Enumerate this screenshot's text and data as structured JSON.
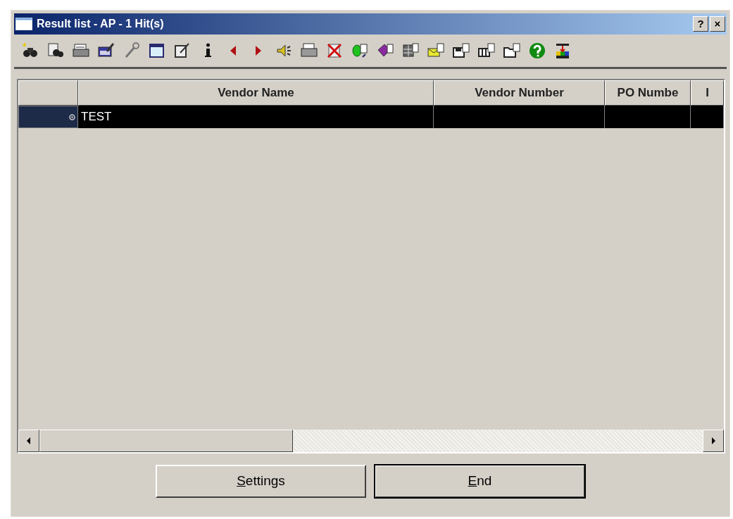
{
  "window": {
    "title": "Result list - AP - 1 Hit(s)",
    "title_buttons": [
      {
        "label": "?"
      },
      {
        "label": "×"
      }
    ]
  },
  "table": {
    "columns": [
      {},
      {
        "label": "Vendor Name"
      },
      {
        "label": "Vendor Number"
      },
      {
        "label": "PO Numbe"
      },
      {
        "label": "I"
      }
    ],
    "rows": [
      {
        "selected": true,
        "cells": [
          "TEST",
          null,
          null,
          null
        ]
      }
    ]
  },
  "buttons": [
    {
      "label_parts": [
        {
          "text": "S",
          "underlined": true
        },
        {
          "text": "ettings",
          "underlined": false
        }
      ],
      "default": false
    },
    {
      "label_parts": [
        {
          "text": "E",
          "underlined": true
        },
        {
          "text": "nd",
          "underlined": false
        }
      ],
      "default": true
    }
  ]
}
